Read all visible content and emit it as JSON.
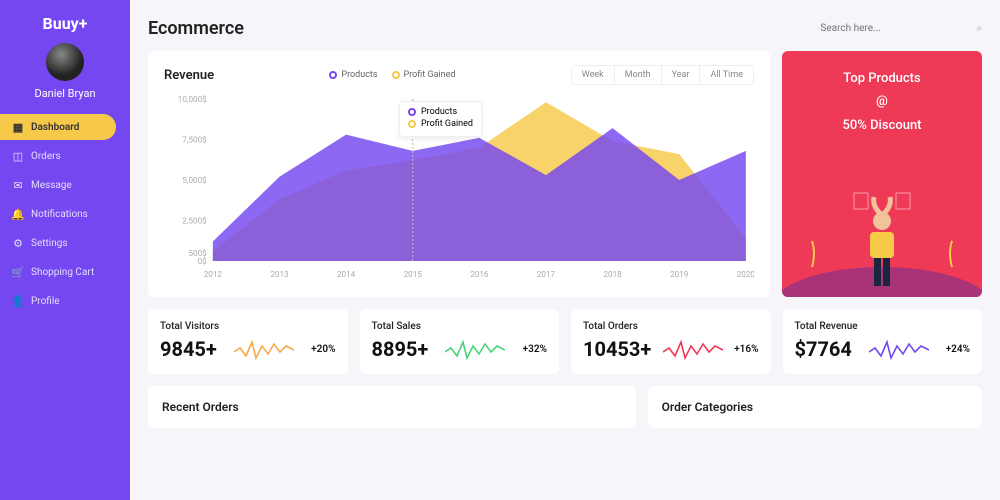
{
  "app": {
    "logo": "Buuy+"
  },
  "user": {
    "name": "Daniel Bryan"
  },
  "sidebar": {
    "items": [
      {
        "icon": "dashboard-icon",
        "label": "Dashboard",
        "active": true
      },
      {
        "icon": "orders-icon",
        "label": "Orders"
      },
      {
        "icon": "message-icon",
        "label": "Message"
      },
      {
        "icon": "notifications-icon",
        "label": "Notifications"
      },
      {
        "icon": "settings-icon",
        "label": "Settings"
      },
      {
        "icon": "cart-icon",
        "label": "Shopping Cart"
      },
      {
        "icon": "profile-icon",
        "label": "Profile"
      }
    ]
  },
  "header": {
    "title": "Ecommerce",
    "search_placeholder": "Search here..."
  },
  "chart": {
    "title": "Revenue",
    "legend": {
      "series1": "Products",
      "series2": "Profit Gained"
    },
    "tooltip": {
      "line1": "Products",
      "line2": "Profit Gained"
    },
    "time_tabs": [
      "Week",
      "Month",
      "Year",
      "All Time"
    ]
  },
  "chart_data": {
    "type": "area",
    "title": "Revenue",
    "xlabel": "",
    "ylabel": "",
    "categories": [
      "2012",
      "2013",
      "2014",
      "2015",
      "2016",
      "2017",
      "2018",
      "2019",
      "2020"
    ],
    "y_ticks": [
      "0$",
      "500$",
      "2,500$",
      "5,000$",
      "7,500$",
      "10,000$"
    ],
    "ylim": [
      0,
      10000
    ],
    "series": [
      {
        "name": "Products",
        "color": "#7447f0",
        "values": [
          1200,
          5200,
          7800,
          6800,
          7600,
          5300,
          8200,
          5000,
          6800
        ]
      },
      {
        "name": "Profit Gained",
        "color": "#f7c948",
        "values": [
          600,
          3800,
          5600,
          6200,
          7000,
          9800,
          7400,
          6600,
          1400
        ]
      }
    ]
  },
  "promo": {
    "line1": "Top Products",
    "line2": "@",
    "line3": "50% Discount"
  },
  "stats": [
    {
      "label": "Total Visitors",
      "value": "9845+",
      "change": "+20%",
      "spark_color": "#f7a948"
    },
    {
      "label": "Total Sales",
      "value": "8895+",
      "change": "+32%",
      "spark_color": "#4bd37b"
    },
    {
      "label": "Total Orders",
      "value": "10453+",
      "change": "+16%",
      "spark_color": "#ee3a57"
    },
    {
      "label": "Total Revenue",
      "value": "$7764",
      "change": "+24%",
      "spark_color": "#7447f0"
    }
  ],
  "bottom": {
    "left_title": "Recent Orders",
    "right_title": "Order Categories"
  }
}
